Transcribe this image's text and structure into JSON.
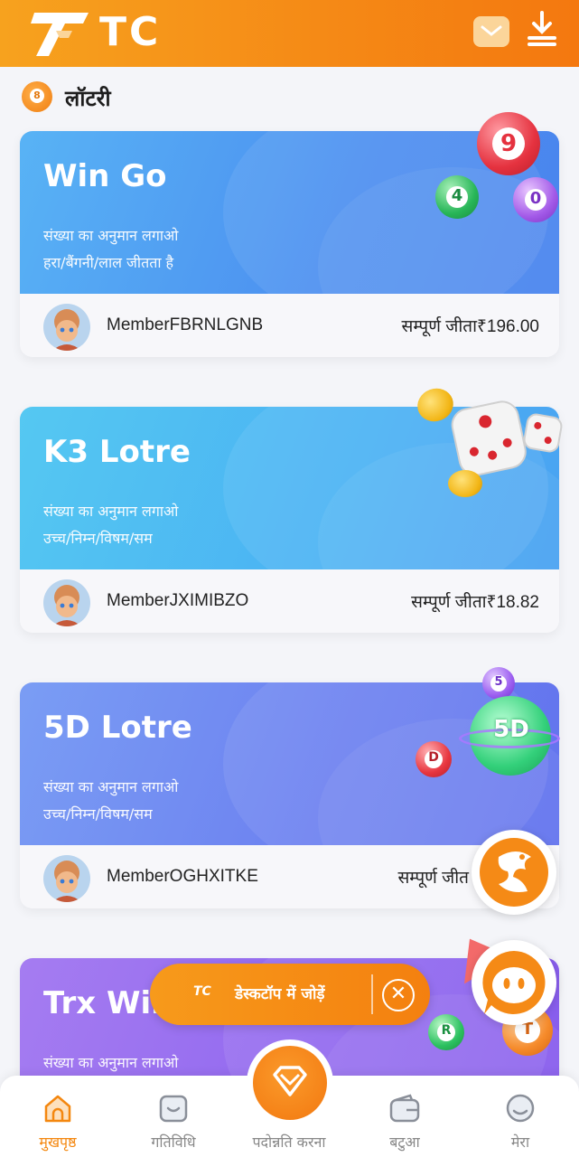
{
  "header": {
    "logo_text": "TC",
    "mail_icon": "mail-icon",
    "download_icon": "download-icon"
  },
  "section": {
    "icon": "lottery-ball-icon",
    "title": "लॉटरी"
  },
  "games": [
    {
      "title": "Win Go",
      "desc_line1": "संख्या का अनुमान लगाओ",
      "desc_line2": "हरा/बैंगनी/लाल जीतता है",
      "member": "MemberFBRNLGNB",
      "winnings": "सम्पूर्ण जीता₹196.00"
    },
    {
      "title": "K3 Lotre",
      "desc_line1": "संख्या का अनुमान लगाओ",
      "desc_line2": "उच्च/निम्न/विषम/सम",
      "member": "MemberJXIMIBZO",
      "winnings": "सम्पूर्ण जीता₹18.82"
    },
    {
      "title": "5D Lotre",
      "desc_line1": "संख्या का अनुमान लगाओ",
      "desc_line2": "उच्च/निम्न/विषम/सम",
      "member": "MemberOGHXITKE",
      "winnings": "सम्पूर्ण जीत"
    },
    {
      "title": "Trx Win",
      "desc_line1": "संख्या का अनुमान लगाओ"
    }
  ],
  "balls": {
    "winGo": [
      "9",
      "4",
      "0"
    ],
    "fiveD": [
      "5",
      "5D",
      "D"
    ],
    "trx": [
      "R",
      "T"
    ]
  },
  "desktop_prompt": {
    "logo": "TC",
    "text": "डेस्कटॉप में जोड़ें",
    "close": "✕"
  },
  "tabbar": {
    "items": [
      {
        "label": "मुखपृष्ठ",
        "icon": "home-icon",
        "active": true
      },
      {
        "label": "गतिविधि",
        "icon": "activity-icon",
        "active": false
      },
      {
        "label": "पदोन्नति करना",
        "icon": "promotion-diamond-icon",
        "active": false
      },
      {
        "label": "बटुआ",
        "icon": "wallet-icon",
        "active": false
      },
      {
        "label": "मेरा",
        "icon": "profile-icon",
        "active": false
      }
    ]
  },
  "colors": {
    "accent": "#f4870f",
    "winGo": "#4c8ff0",
    "k3": "#4ab2f3",
    "fiveD": "#6c80f0",
    "trx": "#9168ef"
  }
}
